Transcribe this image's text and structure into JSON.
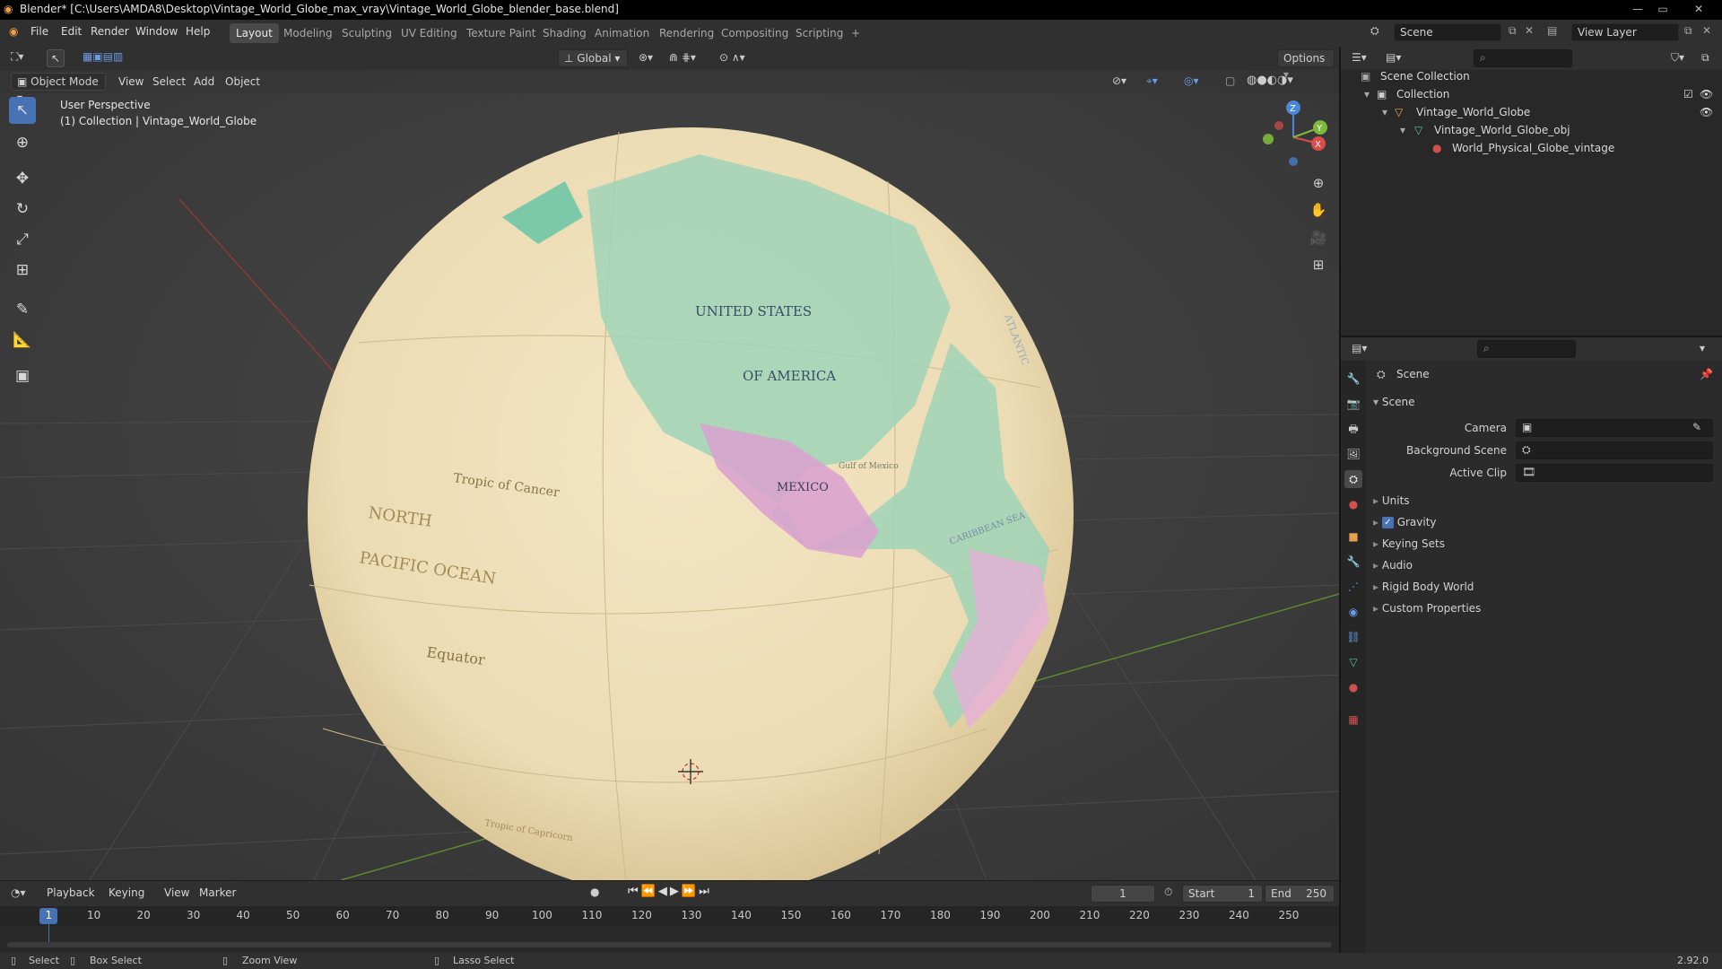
{
  "window": {
    "title": "Blender* [C:\\Users\\AMDA8\\Desktop\\Vintage_World_Globe_max_vray\\Vintage_World_Globe_blender_base.blend]",
    "minimize": "—",
    "maximize": "▭",
    "close": "✕"
  },
  "menus": [
    "File",
    "Edit",
    "Render",
    "Window",
    "Help"
  ],
  "workspaces": [
    "Layout",
    "Modeling",
    "Sculpting",
    "UV Editing",
    "Texture Paint",
    "Shading",
    "Animation",
    "Rendering",
    "Compositing",
    "Scripting"
  ],
  "active_workspace": "Layout",
  "add_workspace": "+",
  "scene_selector": "Scene",
  "view_layer": "View Layer",
  "viewport": {
    "mode": "Object Mode",
    "menus": [
      "View",
      "Select",
      "Add",
      "Object"
    ],
    "transform_orientation": "Global",
    "options": "Options",
    "overlay_line1": "User Perspective",
    "overlay_line2": "(1) Collection | Vintage_World_Globe",
    "globe_labels": [
      "UNITED STATES",
      "OF AMERICA",
      "MEXICO",
      "Gulf of Mexico",
      "Tropic of Cancer",
      "NORTH",
      "PACIFIC OCEAN",
      "Equator",
      "CARIBBEAN SEA",
      "ATLANTIC",
      "Tropic of Capricorn"
    ],
    "gizmo_axes": {
      "x": "X",
      "y": "Y",
      "z": "Z"
    }
  },
  "outliner": {
    "root": "Scene Collection",
    "items": [
      {
        "label": "Collection",
        "depth": 1
      },
      {
        "label": "Vintage_World_Globe",
        "depth": 2
      },
      {
        "label": "Vintage_World_Globe_obj",
        "depth": 3
      },
      {
        "label": "World_Physical_Globe_vintage",
        "depth": 4
      }
    ]
  },
  "properties": {
    "context": "Scene",
    "panel": "Scene",
    "fields": [
      {
        "label": "Camera",
        "value": ""
      },
      {
        "label": "Background Scene",
        "value": ""
      },
      {
        "label": "Active Clip",
        "value": ""
      }
    ],
    "sections": [
      {
        "label": "Units",
        "checkbox": false
      },
      {
        "label": "Gravity",
        "checkbox": true
      },
      {
        "label": "Keying Sets",
        "checkbox": false
      },
      {
        "label": "Audio",
        "checkbox": false
      },
      {
        "label": "Rigid Body World",
        "checkbox": false
      },
      {
        "label": "Custom Properties",
        "checkbox": false
      }
    ]
  },
  "timeline": {
    "menus": [
      "Playback",
      "Keying",
      "View",
      "Marker"
    ],
    "current_frame": "1",
    "start_label": "Start",
    "start": "1",
    "end_label": "End",
    "end": "250",
    "ticks": [
      "1",
      "10",
      "20",
      "30",
      "40",
      "50",
      "60",
      "70",
      "80",
      "90",
      "100",
      "110",
      "120",
      "130",
      "140",
      "150",
      "160",
      "170",
      "180",
      "190",
      "200",
      "210",
      "220",
      "230",
      "240",
      "250"
    ]
  },
  "status": {
    "select": "Select",
    "box_select": "Box Select",
    "zoom_view": "Zoom View",
    "lasso_select": "Lasso Select",
    "version": "2.92.0"
  },
  "colors": {
    "accent": "#4772b3",
    "active_frame": "#4772b3",
    "axis_x": "#d94c4c",
    "axis_y": "#7fb83d",
    "axis_z": "#4a86d9"
  }
}
